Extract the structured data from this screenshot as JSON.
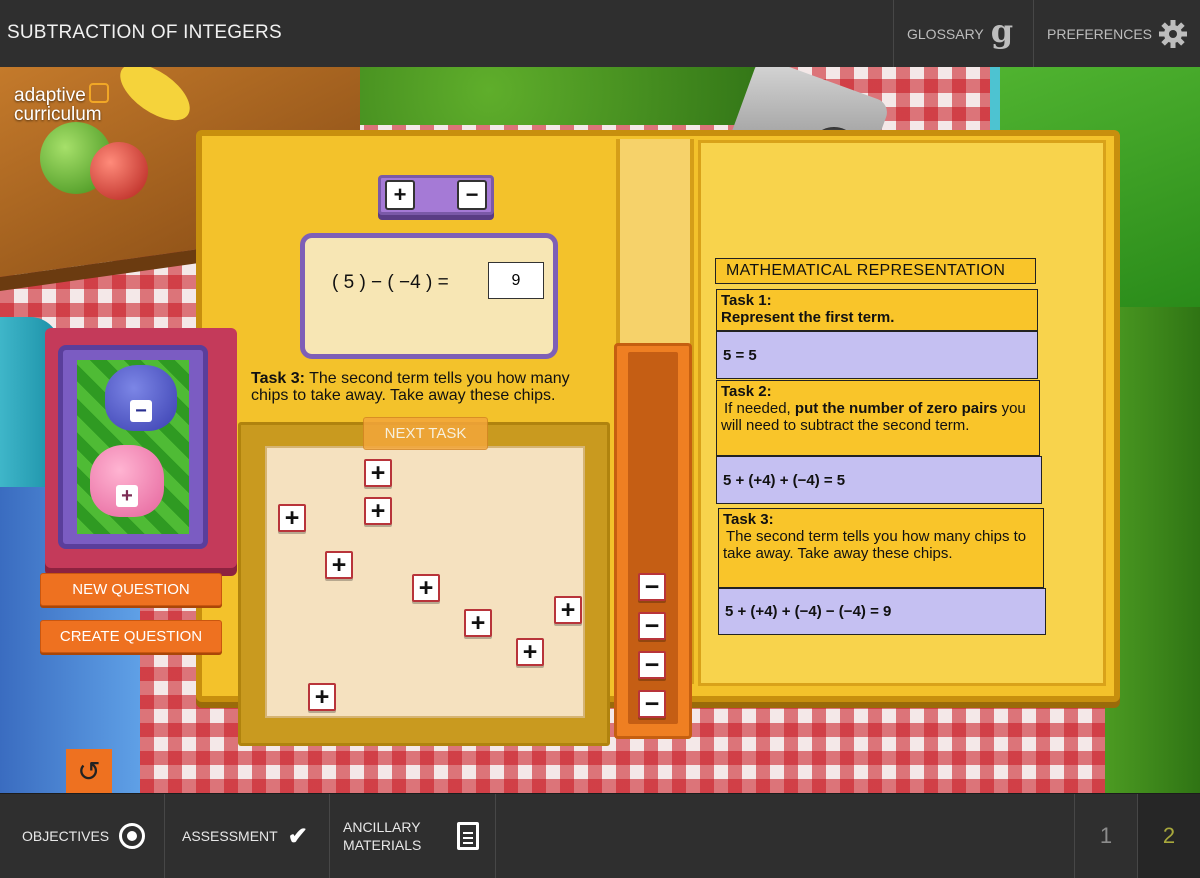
{
  "header": {
    "title": "SUBTRACTION OF INTEGERS",
    "glossary_label": "GLOSSARY",
    "preferences_label": "PREFERENCES"
  },
  "logo": {
    "line1": "adaptive",
    "line2": "curriculum"
  },
  "toggle": {
    "plus": "+",
    "minus": "−"
  },
  "equation": {
    "expression": "( 5 ) − ( −4 ) =",
    "answer": "9"
  },
  "task_prompt": {
    "label": "Task 3:",
    "text": "The second term tells you how many chips to take away. Take away these chips."
  },
  "next_task_label": "NEXT TASK",
  "chips": {
    "positive": [
      "+",
      "+",
      "+",
      "+",
      "+",
      "+",
      "+",
      "+",
      "+",
      "+"
    ],
    "negative_removed": [
      "−",
      "−",
      "−",
      "−"
    ]
  },
  "card": {
    "top_sign": "−",
    "bottom_sign": "+"
  },
  "buttons": {
    "new_question": "NEW QUESTION",
    "create_question": "CREATE QUESTION",
    "reset_symbol": "↺"
  },
  "representation": {
    "title": "MATHEMATICAL REPRESENTATION",
    "tasks": [
      {
        "label": "Task 1:",
        "bold_text": "Represent the first term.",
        "expression": "5 = 5"
      },
      {
        "label": "Task 2:",
        "text_pre": "If needed, ",
        "bold_text": "put the number of zero pairs",
        "text_post": " you will need to subtract the second term.",
        "expression": "5 + (+4) + (−4) = 5"
      },
      {
        "label": "Task 3:",
        "text": "The second term tells you how many chips to take away. Take away these chips.",
        "expression": "5 + (+4) + (−4) − (−4) =  9"
      }
    ]
  },
  "footer": {
    "objectives_label": "OBJECTIVES",
    "assessment_label": "ASSESSMENT",
    "ancillary_line1": "ANCILLARY",
    "ancillary_line2": "MATERIALS",
    "pages": [
      "1",
      "2"
    ],
    "active_page": "2"
  }
}
